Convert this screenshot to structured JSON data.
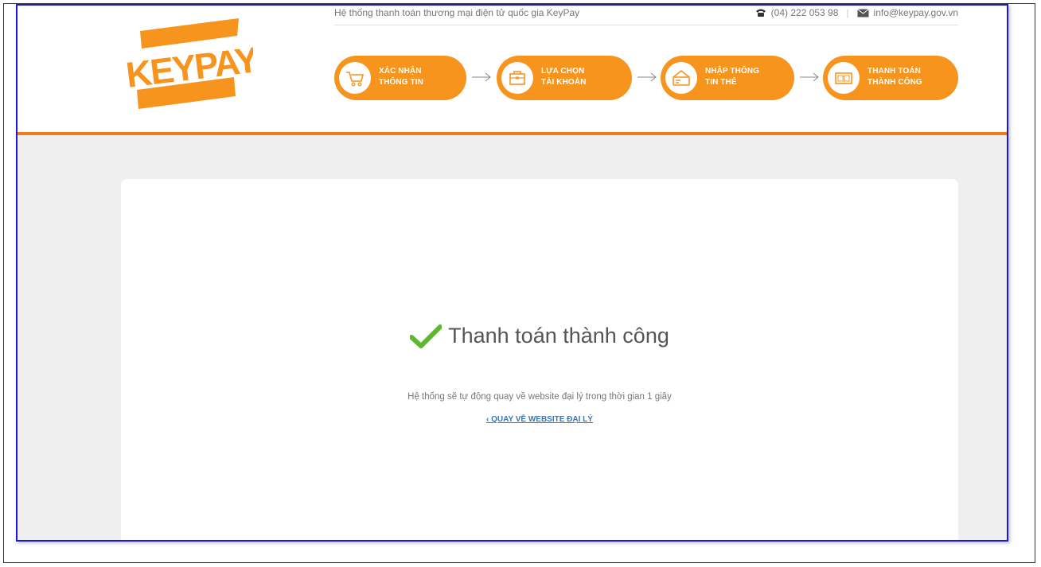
{
  "header": {
    "logo_text": "KEYPAY",
    "tagline": "Hệ thống thanh toán thương mại điện tử quốc gia KeyPay",
    "phone": "(04) 222 053 98",
    "email": "info@keypay.gov.vn"
  },
  "steps": [
    {
      "line1": "XÁC NHẬN",
      "line2": "THÔNG TIN",
      "icon": "cart-icon"
    },
    {
      "line1": "LỰA CHỌN",
      "line2": "TÀI KHOẢN",
      "icon": "briefcase-icon"
    },
    {
      "line1": "NHẬP THÔNG",
      "line2": "TIN THẺ",
      "icon": "card-icon"
    },
    {
      "line1": "THANH TOÁN",
      "line2": "THÀNH CÔNG",
      "icon": "money-icon"
    }
  ],
  "result": {
    "title": "Thanh toán thành công",
    "notice": "Hệ thống sẽ tự động quay về website đại lý trong thời gian 1 giây",
    "back_link": "‹  QUAY VỀ WEBSITE ĐẠI LÝ"
  },
  "colors": {
    "accent": "#f7941d",
    "divider": "#f07a22",
    "success": "#5cb82e",
    "link": "#2b79c2"
  }
}
